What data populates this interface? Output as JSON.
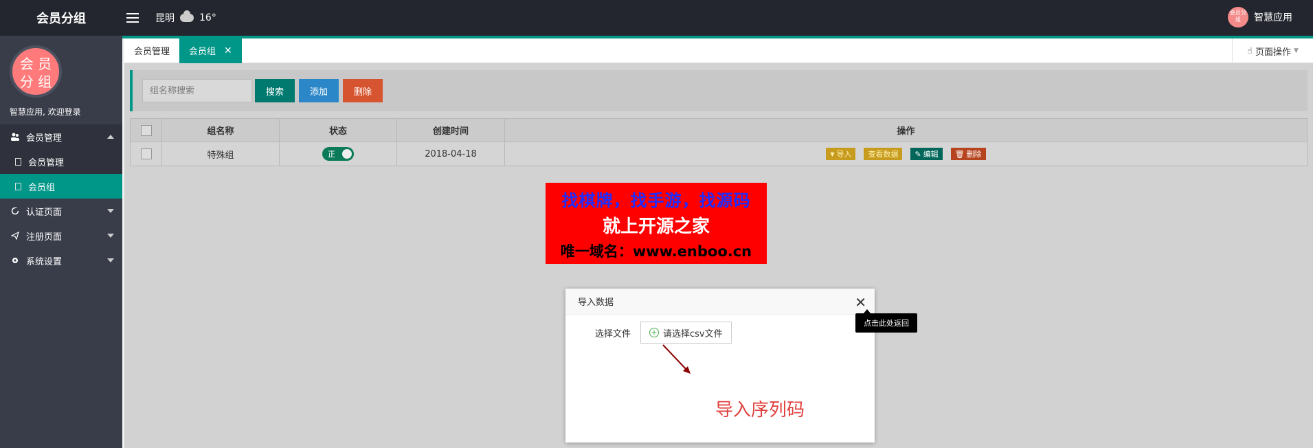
{
  "app": {
    "title": "会员分组"
  },
  "header": {
    "city": "昆明",
    "temperature": "16°",
    "user_name": "智慧应用",
    "avatar_text": "会员分组"
  },
  "sidebar": {
    "avatar_text_1": "会 员",
    "avatar_text_2": "分 组",
    "welcome": "智慧应用, 欢迎登录",
    "items": [
      {
        "label": "会员管理",
        "icon": "users-icon",
        "expanded": true
      },
      {
        "label": "会员管理",
        "icon": "file-icon"
      },
      {
        "label": "会员组",
        "icon": "file-icon",
        "active": true
      },
      {
        "label": "认证页面",
        "icon": "refresh-icon"
      },
      {
        "label": "注册页面",
        "icon": "send-icon"
      },
      {
        "label": "系统设置",
        "icon": "gear-icon"
      }
    ]
  },
  "tabs": [
    {
      "label": "会员管理"
    },
    {
      "label": "会员组",
      "active": true
    }
  ],
  "page_ops": {
    "label": "页面操作"
  },
  "search": {
    "placeholder": "组名称搜索",
    "search_label": "搜索",
    "add_label": "添加",
    "delete_label": "删除"
  },
  "table": {
    "columns": [
      "组名称",
      "状态",
      "创建时间",
      "操作"
    ],
    "rows": [
      {
        "name": "特殊组",
        "status": "正",
        "created": "2018-04-18"
      }
    ],
    "actions": {
      "import": "导入",
      "view": "查看数据",
      "edit": "编辑",
      "delete": "删除"
    }
  },
  "ad": {
    "line1": "找棋牌，找手游，找源码",
    "line2": "就上开源之家",
    "line3": "唯一域名：www.enboo.cn"
  },
  "modal": {
    "title": "导入数据",
    "close_tooltip": "点击此处返回",
    "file_label": "选择文件",
    "file_button": "请选择csv文件",
    "note": "导入序列码"
  },
  "colors": {
    "accent": "#009688",
    "sidebar": "#393d49",
    "topbar": "#23262e",
    "danger": "#d65530",
    "primary": "#2c87c9"
  }
}
